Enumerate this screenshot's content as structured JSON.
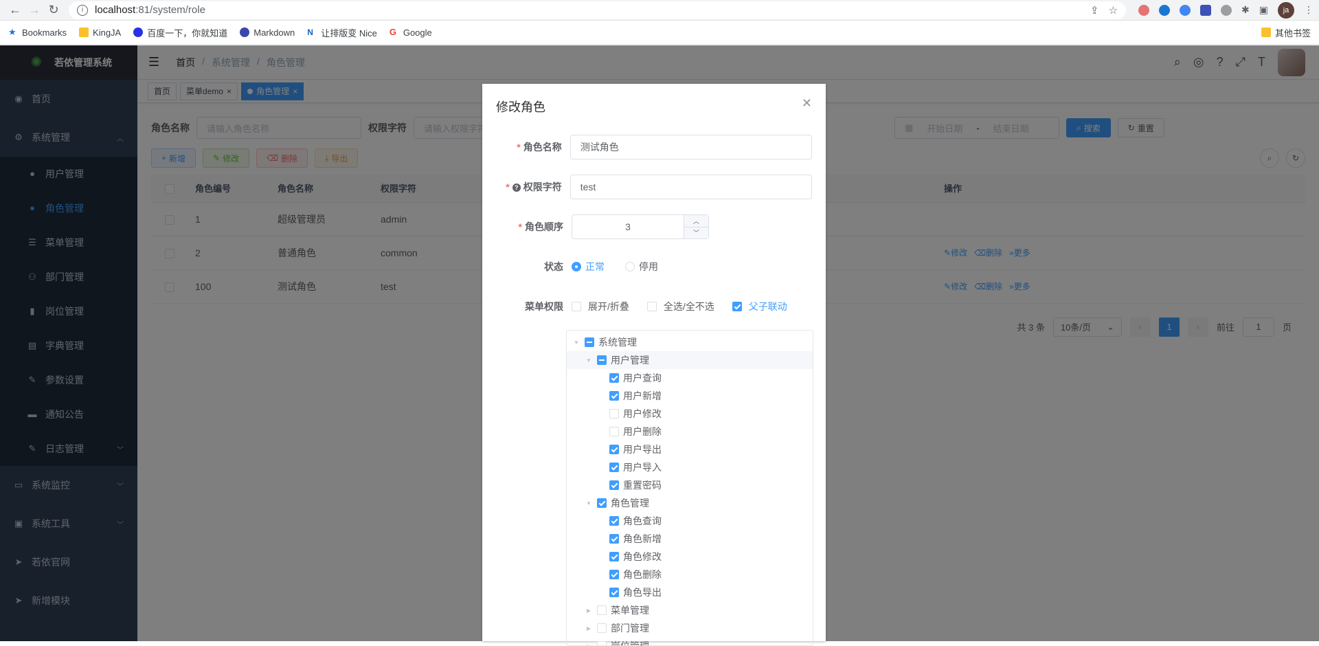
{
  "browser": {
    "url_host": "localhost",
    "url_rest": ":81/system/role",
    "bookmarks": [
      "Bookmarks",
      "KingJA",
      "百度一下，你就知道",
      "Markdown",
      "让排版变 Nice",
      "Google"
    ],
    "bookmarks_right": "其他书签",
    "profile_initials": "ja"
  },
  "app": {
    "title": "若依管理系统",
    "menu": {
      "home": "首页",
      "system": "系统管理",
      "users": "用户管理",
      "roles": "角色管理",
      "menus": "菜单管理",
      "depts": "部门管理",
      "posts": "岗位管理",
      "dict": "字典管理",
      "params": "参数设置",
      "notice": "通知公告",
      "logs": "日志管理",
      "monitor": "系统监控",
      "tools": "系统工具",
      "website": "若依官网",
      "newmodule": "新增模块"
    },
    "breadcrumb": [
      "首页",
      "/",
      "系统管理",
      "/",
      "角色管理"
    ],
    "tags": [
      "首页",
      "菜单demo",
      "角色管理"
    ]
  },
  "search": {
    "role_name_label": "角色名称",
    "role_name_placeholder": "请输入角色名称",
    "perm_label": "权限字符",
    "perm_placeholder": "请输入权限字符",
    "start_date": "开始日期",
    "end_date": "结束日期",
    "search_btn": "搜索",
    "reset_btn": "重置"
  },
  "toolbar": {
    "add": "新增",
    "edit": "修改",
    "delete": "删除",
    "export": "导出"
  },
  "table": {
    "headers": [
      "角色编号",
      "角色名称",
      "权限字符",
      "操作"
    ],
    "rows": [
      {
        "id": "1",
        "name": "超级管理员",
        "key": "admin"
      },
      {
        "id": "2",
        "name": "普通角色",
        "key": "common"
      },
      {
        "id": "100",
        "name": "测试角色",
        "key": "test"
      }
    ],
    "ops": {
      "edit": "修改",
      "delete": "删除",
      "more": "更多"
    }
  },
  "pager": {
    "total": "共 3 条",
    "size": "10条/页",
    "current": "1",
    "goto_label": "前往",
    "goto_value": "1",
    "page_suffix": "页"
  },
  "dialog": {
    "title": "修改角色",
    "role_name_label": "角色名称",
    "role_name_value": "测试角色",
    "perm_label": "权限字符",
    "perm_value": "test",
    "order_label": "角色顺序",
    "order_value": "3",
    "status_label": "状态",
    "status_normal": "正常",
    "status_disabled": "停用",
    "menu_perm_label": "菜单权限",
    "expand": "展开/折叠",
    "select_all": "全选/全不选",
    "linkage": "父子联动",
    "tree": [
      {
        "label": "系统管理",
        "level": 0,
        "state": "half",
        "caret": "down"
      },
      {
        "label": "用户管理",
        "level": 1,
        "state": "half",
        "caret": "down",
        "hl": true
      },
      {
        "label": "用户查询",
        "level": 2,
        "state": "on"
      },
      {
        "label": "用户新增",
        "level": 2,
        "state": "on"
      },
      {
        "label": "用户修改",
        "level": 2,
        "state": "off"
      },
      {
        "label": "用户删除",
        "level": 2,
        "state": "off"
      },
      {
        "label": "用户导出",
        "level": 2,
        "state": "on"
      },
      {
        "label": "用户导入",
        "level": 2,
        "state": "on"
      },
      {
        "label": "重置密码",
        "level": 2,
        "state": "on"
      },
      {
        "label": "角色管理",
        "level": 1,
        "state": "on",
        "caret": "down"
      },
      {
        "label": "角色查询",
        "level": 2,
        "state": "on"
      },
      {
        "label": "角色新增",
        "level": 2,
        "state": "on"
      },
      {
        "label": "角色修改",
        "level": 2,
        "state": "on"
      },
      {
        "label": "角色删除",
        "level": 2,
        "state": "on"
      },
      {
        "label": "角色导出",
        "level": 2,
        "state": "on"
      },
      {
        "label": "菜单管理",
        "level": 1,
        "state": "off",
        "caret": "right"
      },
      {
        "label": "部门管理",
        "level": 1,
        "state": "off",
        "caret": "right"
      },
      {
        "label": "岗位管理",
        "level": 1,
        "state": "off",
        "caret": "right"
      }
    ]
  }
}
